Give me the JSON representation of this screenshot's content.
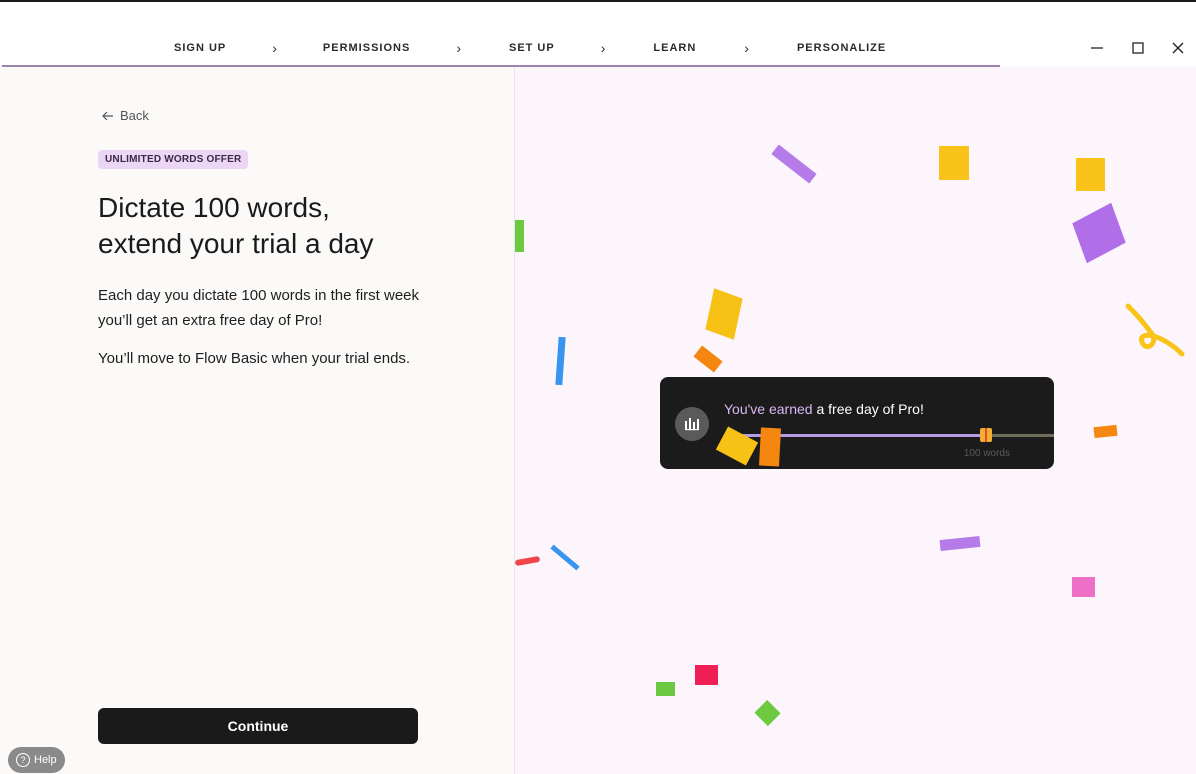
{
  "steps": [
    "SIGN UP",
    "PERMISSIONS",
    "SET UP",
    "LEARN",
    "PERSONALIZE"
  ],
  "back_label": "Back",
  "badge": "UNLIMITED WORDS OFFER",
  "title_line1": "Dictate 100 words,",
  "title_line2": "extend your trial a day",
  "para1": "Each day you dictate 100 words in the first week you’ll get an extra free day of Pro!",
  "para2": "You’ll move to Flow Basic when your trial ends.",
  "continue_label": "Continue",
  "help_label": "Help",
  "card": {
    "message_highlight": "You've earned",
    "message_rest": " a free day of Pro!",
    "progress": 0.78,
    "words_label": "100 words"
  },
  "colors": {
    "accent": "#b89be6",
    "badge_bg": "#ecd6f5",
    "button_bg": "#1a1a1a"
  }
}
